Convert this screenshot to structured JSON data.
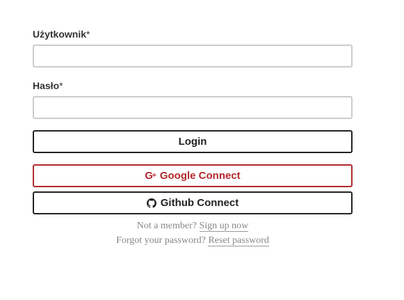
{
  "form": {
    "username": {
      "label": "Użytkownik",
      "required_mark": "*",
      "value": "",
      "placeholder": ""
    },
    "password": {
      "label": "Hasło",
      "required_mark": "*",
      "value": "",
      "placeholder": ""
    },
    "login_label": "Login",
    "google_label": "Google Connect",
    "google_icon": "google-plus-icon",
    "google_color": "#b3282d",
    "github_label": "Github Connect",
    "github_icon": "github-icon"
  },
  "footer": {
    "not_member_text": "Not a member?",
    "signup_link": "Sign up now",
    "forgot_text": "Forgot your password?",
    "reset_link": "Reset password"
  }
}
